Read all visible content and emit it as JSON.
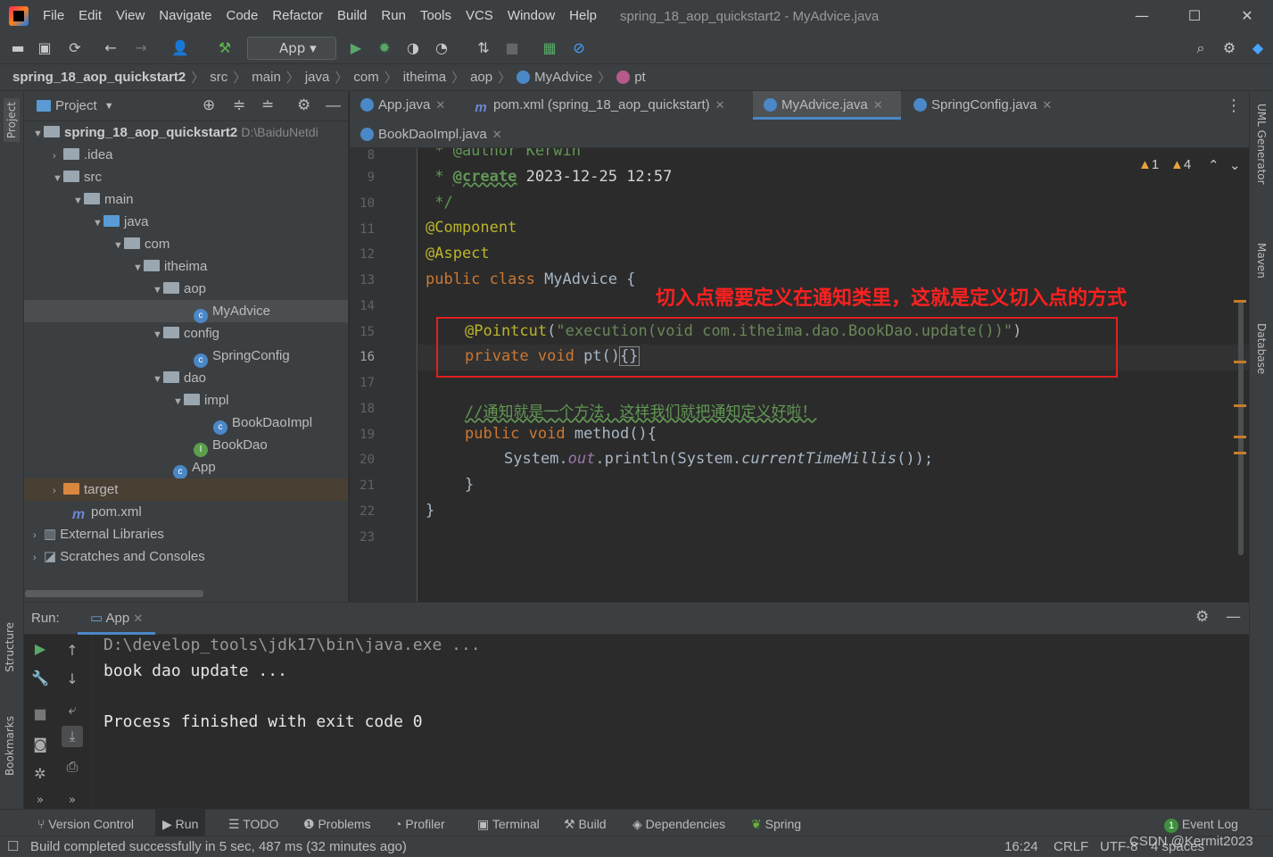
{
  "window": {
    "title": "spring_18_aop_quickstart2 - MyAdvice.java"
  },
  "menu": [
    "File",
    "Edit",
    "View",
    "Navigate",
    "Code",
    "Refactor",
    "Build",
    "Run",
    "Tools",
    "VCS",
    "Window",
    "Help"
  ],
  "toolbar": {
    "run_config": "App"
  },
  "breadcrumb": [
    "spring_18_aop_quickstart2",
    "src",
    "main",
    "java",
    "com",
    "itheima",
    "aop",
    "MyAdvice",
    "pt"
  ],
  "project": {
    "header": "Project",
    "root_name": "spring_18_aop_quickstart2",
    "root_path": "D:\\BaiduNetdi",
    "items": [
      ".idea",
      "src",
      "main",
      "java",
      "com",
      "itheima",
      "aop",
      "MyAdvice",
      "config",
      "SpringConfig",
      "dao",
      "impl",
      "BookDaoImpl",
      "BookDao",
      "App",
      "target",
      "pom.xml",
      "External Libraries",
      "Scratches and Consoles"
    ]
  },
  "tabs": [
    "App.java",
    "pom.xml (spring_18_aop_quickstart)",
    "MyAdvice.java",
    "SpringConfig.java",
    "BookDaoImpl.java"
  ],
  "editor": {
    "line_numbers": [
      "8",
      "9",
      "10",
      "11",
      "12",
      "13",
      "14",
      "15",
      "16",
      "17",
      "18",
      "19",
      "20",
      "21",
      "22",
      "23"
    ],
    "warnings": {
      "weak": "1",
      "warn": "4"
    },
    "code": {
      "l8": " * @author Kerwin",
      "l9_a": " * ",
      "l9_b": "@create",
      " l9_c": "",
      "l9_date": " 2023-12-25 12:57",
      "l10": " */",
      "l11": "@Component",
      "l12": "@Aspect",
      "l13_a": "public class ",
      "l13_b": "MyAdvice {",
      "l15_a": "@Pointcut",
      "l15_b": "(",
      "l15_c": "\"execution(void com.itheima.dao.BookDao.update())\"",
      "l15_d": ")",
      "l16_a": "private void ",
      "l16_b": "pt()",
      "l16_c": "{}",
      "l18": "//通知就是一个方法，这样我们就把通知定义好啦！",
      "l19_a": "public void ",
      "l19_b": "method(){",
      "l20_a": "System.",
      "l20_b": "out",
      ".l20_c": "",
      "l20_dot": ".",
      "l20_c": "println",
      "l20_d": "(System.",
      "l20_e": "currentTimeMillis",
      "l20_f": "());",
      "l21": "}",
      "l22": "}"
    },
    "annotation": "切入点需要定义在通知类里，这就是定义切入点的方式"
  },
  "run": {
    "label": "Run:",
    "tab": "App",
    "console": [
      "D:\\develop_tools\\jdk17\\bin\\java.exe ...",
      "book dao update ...",
      "",
      "Process finished with exit code 0"
    ]
  },
  "bottom_tools": [
    "Version Control",
    "Run",
    "TODO",
    "Problems",
    "Profiler",
    "Terminal",
    "Build",
    "Dependencies",
    "Spring",
    "Event Log"
  ],
  "event_log_count": "1",
  "status": {
    "message": "Build completed successfully in 5 sec, 487 ms (32 minutes ago)",
    "position": "16:24",
    "line_sep": "CRLF",
    "encoding": "UTF-8",
    "indent": "4 spaces",
    "watermark": "CSDN @Kermit2023"
  },
  "side_tabs": {
    "left": [
      "Project",
      "Structure",
      "Bookmarks"
    ],
    "right": [
      "UML Generator",
      "Maven",
      "Database"
    ]
  },
  "colors": {
    "accent": "#4a88c7",
    "annotation": "#ff2020",
    "keyword": "#cc7832",
    "annotation_code": "#bbb529",
    "string": "#6a8759"
  }
}
